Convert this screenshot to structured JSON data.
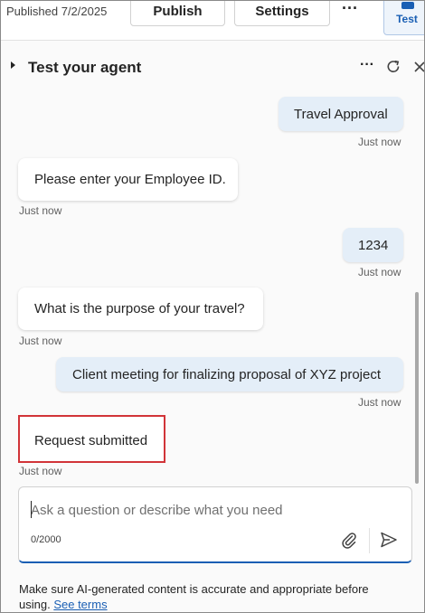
{
  "topbar": {
    "published": "Published 7/2/2025",
    "publish_label": "Publish",
    "settings_label": "Settings",
    "more_label": "···",
    "test_label": "Test"
  },
  "panel": {
    "title": "Test your agent",
    "more_label": "···"
  },
  "chat": {
    "messages": [
      {
        "role": "user",
        "text": "Travel Approval",
        "time": "Just now"
      },
      {
        "role": "bot",
        "text": "Please enter your Employee ID.",
        "time": "Just now"
      },
      {
        "role": "user",
        "text": "1234",
        "time": "Just now"
      },
      {
        "role": "bot",
        "text": "What is the purpose of your travel?",
        "time": "Just now"
      },
      {
        "role": "user",
        "text": "Client meeting for finalizing proposal of XYZ project",
        "time": "Just now"
      },
      {
        "role": "bot",
        "text": "Request submitted",
        "time": "Just now"
      }
    ]
  },
  "composer": {
    "placeholder": "Ask a question or describe what you need",
    "value": "",
    "counter": "0/2000"
  },
  "footer": {
    "disclaimer": "Make sure AI-generated content is accurate and appropriate before using.",
    "link_label": "See terms"
  },
  "colors": {
    "accent": "#1a5fb4",
    "user_bubble": "#e4eef8",
    "highlight_border": "#d13438"
  }
}
